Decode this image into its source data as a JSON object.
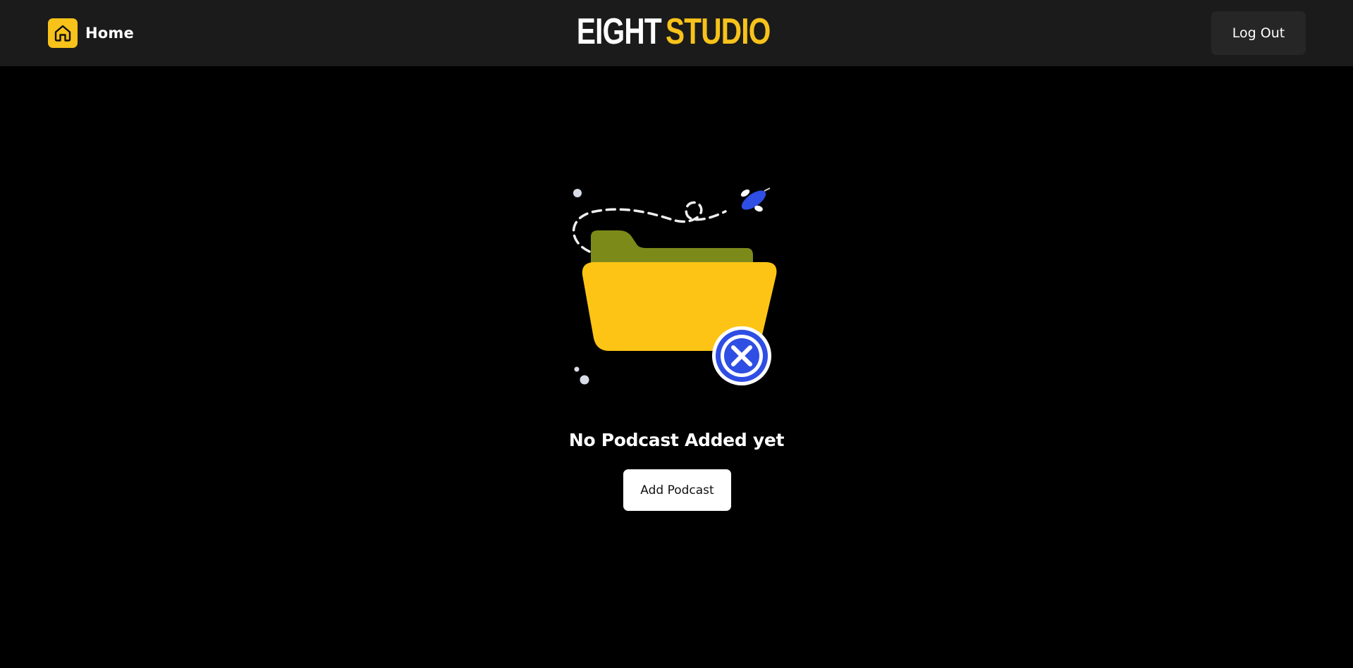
{
  "header": {
    "home_label": "Home",
    "brand_part1": "EIGHT",
    "brand_part2": "STUDIO",
    "logout_label": "Log Out"
  },
  "empty_state": {
    "title": "No Podcast Added yet",
    "add_button_label": "Add Podcast",
    "illustration": "empty-folder-icon"
  },
  "colors": {
    "accent": "#f7c21a",
    "topbar_bg": "#1b1b1b",
    "page_bg": "#000000",
    "folder_front": "#fdc415",
    "folder_back": "#7c8a1a",
    "close_badge": "#2f4ee4"
  }
}
